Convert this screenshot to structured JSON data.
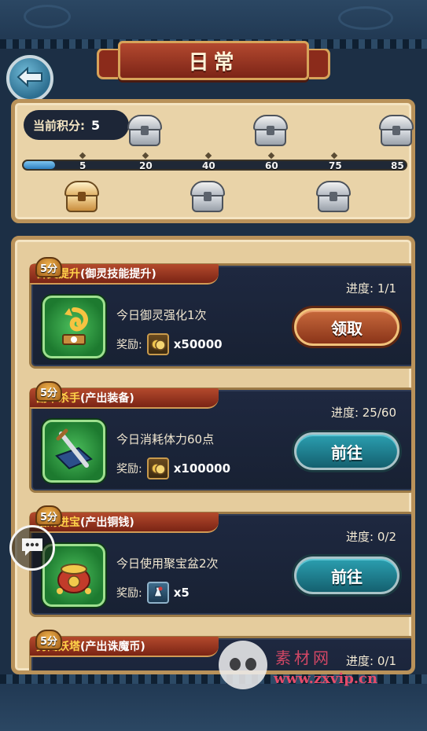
{
  "header": {
    "title": "日常"
  },
  "score": {
    "label": "当前积分:",
    "value": "5",
    "progress": 0.083,
    "ticks": [
      "5",
      "20",
      "40",
      "60",
      "75",
      "85"
    ]
  },
  "quests": [
    {
      "points": "5分",
      "name": "御灵提升",
      "sub": "(御灵技能提升)",
      "progress": "进度: 1/1",
      "desc": "今日御灵强化1次",
      "reward_label": "奖励:",
      "reward_amount": "x50000",
      "reward_icon": "coin-icon",
      "button": "领取",
      "button_type": "claim"
    },
    {
      "points": "5分",
      "name": "副本杀手",
      "sub": "(产出装备)",
      "progress": "进度: 25/60",
      "desc": "今日消耗体力60点",
      "reward_label": "奖励:",
      "reward_amount": "x100000",
      "reward_icon": "coin-icon",
      "button": "前往",
      "button_type": "go"
    },
    {
      "points": "5分",
      "name": "招财进宝",
      "sub": "(产出铜钱)",
      "progress": "进度: 0/2",
      "desc": "今日使用聚宝盆2次",
      "reward_label": "奖励:",
      "reward_amount": "x5",
      "reward_icon": "potion-icon",
      "button": "前往",
      "button_type": "go"
    },
    {
      "points": "5分",
      "name": "勇闯妖塔",
      "sub": "(产出诛魔币)",
      "progress": "进度: 0/1"
    }
  ],
  "watermark": {
    "title": "素材网",
    "url": "www.zxvip.cn"
  },
  "colors": {
    "claim": "#8a3419",
    "go": "#14606f",
    "accent": "#ffd34a"
  }
}
